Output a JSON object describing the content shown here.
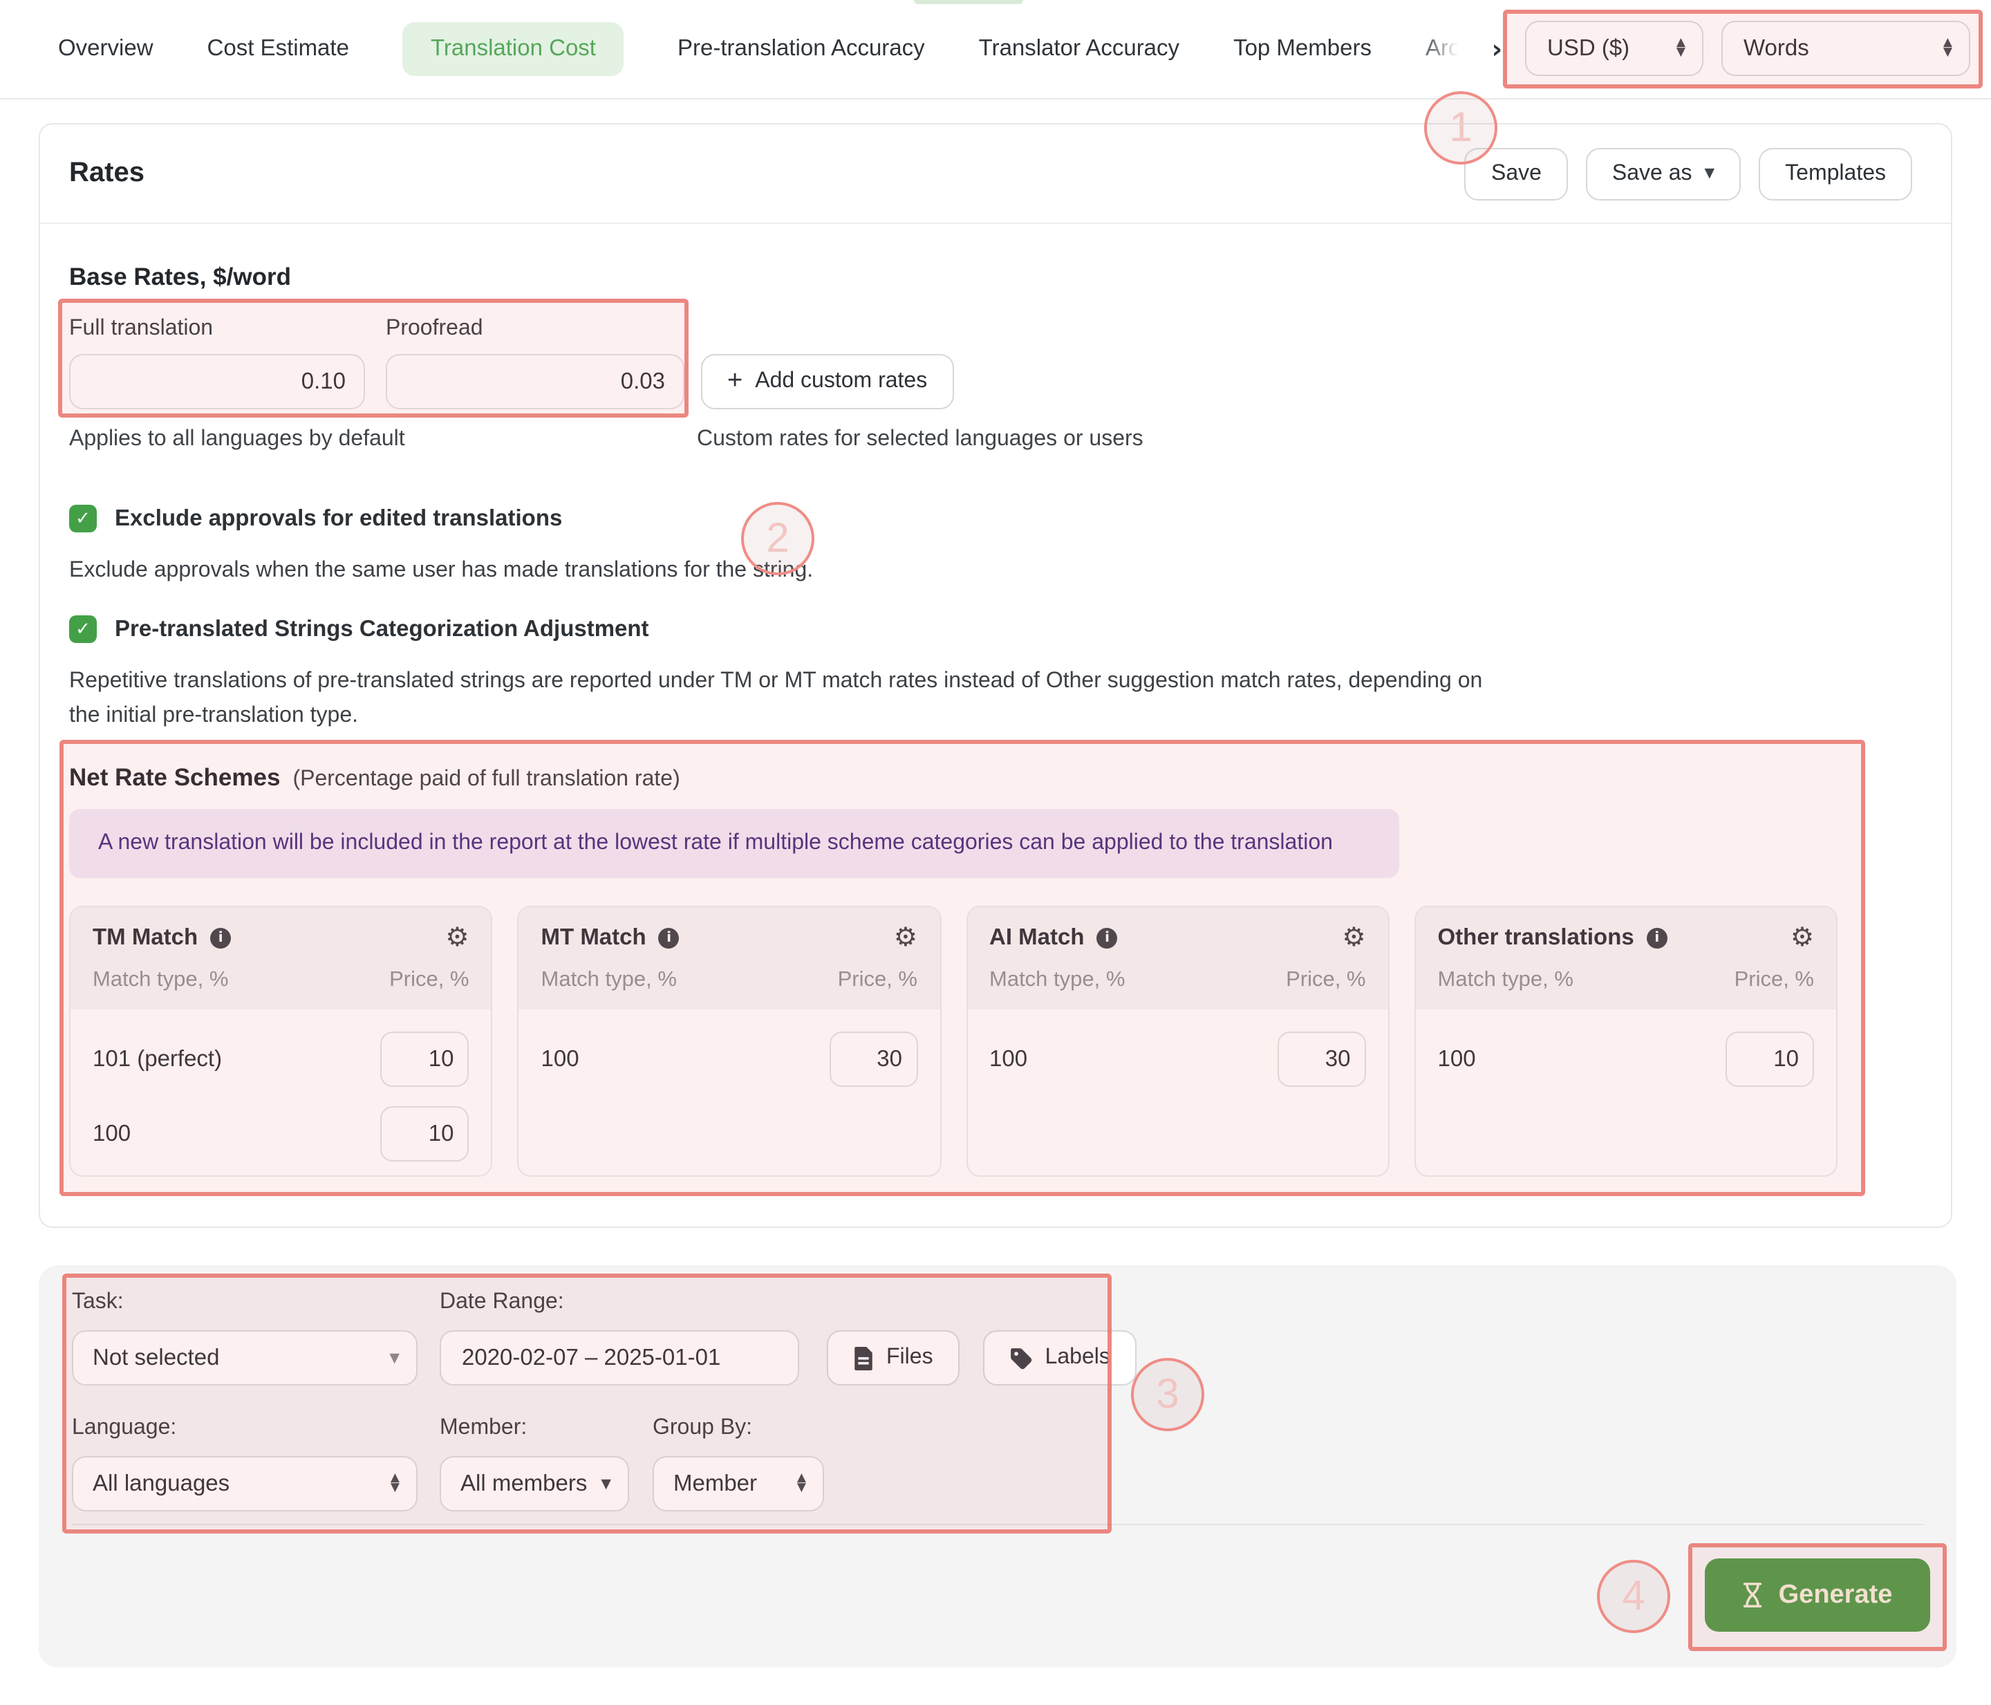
{
  "tabs": {
    "items": [
      {
        "label": "Overview",
        "active": false
      },
      {
        "label": "Cost Estimate",
        "active": false
      },
      {
        "label": "Translation Cost",
        "active": true
      },
      {
        "label": "Pre-translation Accuracy",
        "active": false
      },
      {
        "label": "Translator Accuracy",
        "active": false
      },
      {
        "label": "Top Members",
        "active": false
      },
      {
        "label": "Arc",
        "active": false,
        "truncated": true
      }
    ]
  },
  "top_controls": {
    "currency_value": "USD ($)",
    "unit_value": "Words"
  },
  "rates_card": {
    "title": "Rates",
    "buttons": {
      "save": "Save",
      "save_as": "Save as",
      "templates": "Templates"
    },
    "base_rates": {
      "heading": "Base Rates, $/word",
      "fields": [
        {
          "label": "Full translation",
          "value": "0.10"
        },
        {
          "label": "Proofread",
          "value": "0.03"
        }
      ],
      "add_button": "Add custom rates",
      "left_note": "Applies to all languages by default",
      "right_note": "Custom rates for selected languages or users"
    },
    "options": [
      {
        "label": "Exclude approvals for edited translations",
        "checked": true,
        "description": "Exclude approvals when the same user has made translations for the string."
      },
      {
        "label": "Pre-translated Strings Categorization Adjustment",
        "checked": true,
        "description": "Repetitive translations of pre-translated strings are reported under TM or MT match rates instead of Other suggestion match rates, depending on the initial pre-translation type."
      }
    ],
    "net_rate_schemes": {
      "title": "Net Rate Schemes",
      "subtitle": "(Percentage paid of full translation rate)",
      "banner": "A new translation will be included in the report at the lowest rate if multiple scheme categories can be applied to the translation",
      "col_header_left": "Match type, %",
      "col_header_right": "Price, %",
      "columns": [
        {
          "title": "TM Match",
          "rows": [
            {
              "match": "101 (perfect)",
              "price": "10"
            },
            {
              "match": "100",
              "price": "10"
            }
          ]
        },
        {
          "title": "MT Match",
          "rows": [
            {
              "match": "100",
              "price": "30"
            }
          ]
        },
        {
          "title": "AI Match",
          "rows": [
            {
              "match": "100",
              "price": "30"
            }
          ]
        },
        {
          "title": "Other translations",
          "rows": [
            {
              "match": "100",
              "price": "10"
            }
          ]
        }
      ]
    }
  },
  "filters": {
    "task": {
      "label": "Task:",
      "value": "Not selected"
    },
    "date_range": {
      "label": "Date Range:",
      "value": "2020-02-07 – 2025-01-01"
    },
    "files_button": "Files",
    "labels_button": "Labels",
    "language": {
      "label": "Language:",
      "value": "All languages"
    },
    "member": {
      "label": "Member:",
      "value": "All members"
    },
    "group_by": {
      "label": "Group By:",
      "value": "Member"
    }
  },
  "generate_button": "Generate",
  "annotations": [
    {
      "number": "1"
    },
    {
      "number": "2"
    },
    {
      "number": "3"
    },
    {
      "number": "4"
    }
  ],
  "colors": {
    "tab_active_bg": "#e3f2e3",
    "tab_active_text": "#56a75a",
    "checkbox_green": "#43a047",
    "generate_green": "#4f9a48",
    "banner_bg": "#f1eaf8",
    "banner_text": "#4a2d80",
    "annotation_red": "#e8746c"
  }
}
